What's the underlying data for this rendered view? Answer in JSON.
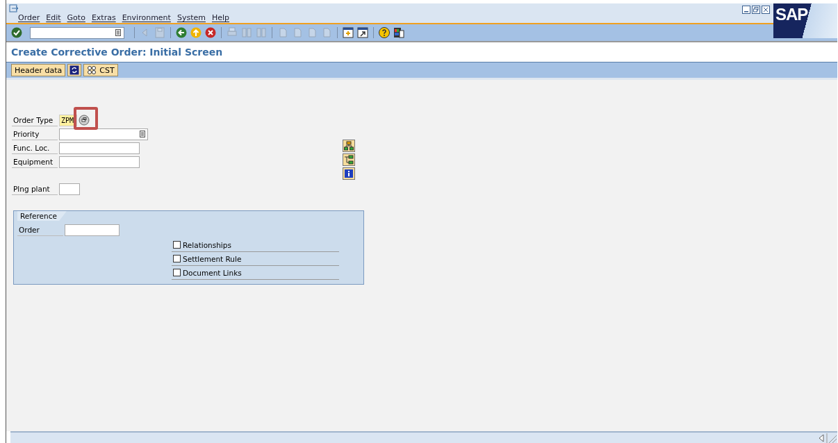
{
  "window": {
    "logo": "SAP"
  },
  "menu": [
    "Order",
    "Edit",
    "Goto",
    "Extras",
    "Environment",
    "System",
    "Help"
  ],
  "toolbar": [
    {
      "kind": "enter",
      "disabled": false
    },
    {
      "kind": "command"
    },
    {
      "kind": "sep"
    },
    {
      "kind": "prev",
      "disabled": true
    },
    {
      "kind": "save",
      "disabled": true
    },
    {
      "kind": "sep"
    },
    {
      "kind": "back",
      "disabled": false
    },
    {
      "kind": "exit",
      "disabled": false
    },
    {
      "kind": "cancel",
      "disabled": false
    },
    {
      "kind": "sep"
    },
    {
      "kind": "print",
      "disabled": true
    },
    {
      "kind": "find",
      "disabled": true
    },
    {
      "kind": "findnext",
      "disabled": true
    },
    {
      "kind": "sep"
    },
    {
      "kind": "page",
      "disabled": true
    },
    {
      "kind": "page",
      "disabled": true
    },
    {
      "kind": "page",
      "disabled": true
    },
    {
      "kind": "page",
      "disabled": true
    },
    {
      "kind": "sep"
    },
    {
      "kind": "session",
      "disabled": false
    },
    {
      "kind": "shortcut",
      "disabled": false
    },
    {
      "kind": "sep"
    },
    {
      "kind": "help",
      "disabled": false
    },
    {
      "kind": "layout",
      "disabled": false
    }
  ],
  "title": "Create Corrective Order: Initial Screen",
  "app_toolbar": [
    {
      "kind": "text",
      "label": "Header data"
    },
    {
      "kind": "icon"
    },
    {
      "kind": "icon_text",
      "label": "CST"
    }
  ],
  "fields": [
    {
      "kind": "required_help",
      "label": "Order Type",
      "value": "ZPM",
      "highlighted": true
    },
    {
      "kind": "select",
      "label": "Priority"
    },
    {
      "kind": "text",
      "label": "Func. Loc."
    },
    {
      "kind": "text",
      "label": "Equipment"
    },
    {
      "kind": "short",
      "label": "Plng plant"
    }
  ],
  "reference": {
    "title": "Reference",
    "fields": [
      {
        "label": "Order"
      }
    ],
    "checkboxes": [
      {
        "label": "Relationships",
        "checked": false
      },
      {
        "label": "Settlement Rule",
        "checked": false
      },
      {
        "label": "Document Links",
        "checked": false
      }
    ]
  }
}
